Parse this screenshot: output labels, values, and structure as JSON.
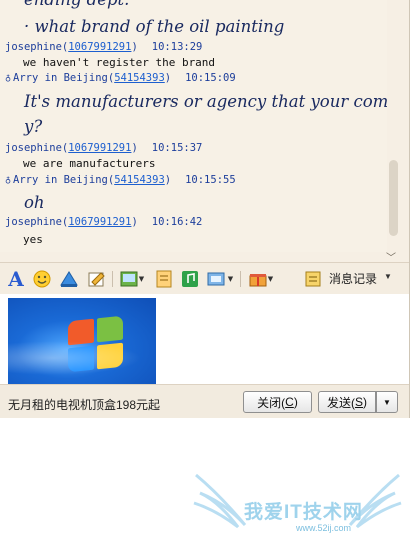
{
  "chat": {
    "cut_top_line": "ending dept.",
    "messages": [
      {
        "type": "big",
        "text": "· what brand of the oil painting"
      },
      {
        "type": "header",
        "sender": "josephine",
        "id": "1067991291",
        "time": "10:13:29"
      },
      {
        "type": "plain",
        "text": "we haven't register the brand"
      },
      {
        "type": "header",
        "sender": "Arry in Beijing",
        "id": "54154393",
        "time": "10:15:09",
        "icon": "person-icon"
      },
      {
        "type": "big",
        "text": "It's manufacturers or agency that your compan"
      },
      {
        "type": "big",
        "text": "y?"
      },
      {
        "type": "header",
        "sender": "josephine",
        "id": "1067991291",
        "time": "10:15:37"
      },
      {
        "type": "plain",
        "text": "we are manufacturers"
      },
      {
        "type": "header",
        "sender": "Arry in Beijing",
        "id": "54154393",
        "time": "10:15:55",
        "icon": "person-icon"
      },
      {
        "type": "big",
        "text": "oh"
      },
      {
        "type": "header",
        "sender": "josephine",
        "id": "1067991291",
        "time": "10:16:42"
      },
      {
        "type": "plain",
        "text": "yes"
      }
    ]
  },
  "toolbar": {
    "icons": [
      "font-icon",
      "emoji-icon",
      "wave-icon",
      "scribble-icon",
      "image-icon",
      "document-icon",
      "music-icon",
      "screenshot-icon",
      "gift-icon"
    ],
    "history_label": "消息记录",
    "history_dropdown": "▼"
  },
  "bottom": {
    "ad_text": "无月租的电视机顶盒198元起",
    "close_label": "关闭(",
    "close_key": "C",
    "close_end": ")",
    "send_label": "发送(",
    "send_key": "S",
    "send_end": ")",
    "send_dropdown": "▼"
  },
  "watermark": {
    "text": "我爱IT技术网",
    "url": "www.52ij.com"
  },
  "colors": {
    "chat_bg": "#f6efe4",
    "header_blue": "#1d3e9b",
    "link_blue": "#1d5fcf",
    "big_text": "#1a2a60"
  }
}
